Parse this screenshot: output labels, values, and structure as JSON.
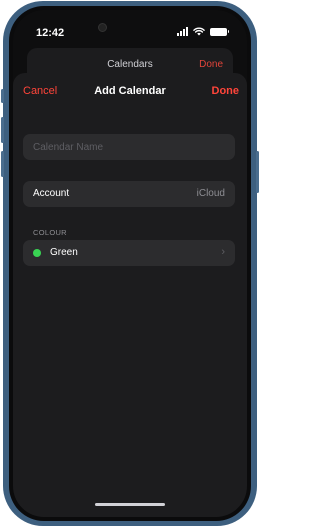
{
  "status_bar": {
    "time": "12:42"
  },
  "background_sheet": {
    "title": "Calendars",
    "done_label": "Done"
  },
  "nav": {
    "cancel_label": "Cancel",
    "title": "Add Calendar",
    "done_label": "Done"
  },
  "form": {
    "name_placeholder": "Calendar Name",
    "name_value": "",
    "account_label": "Account",
    "account_value": "iCloud",
    "colour_section_header": "COLOUR",
    "colour_label": "Green",
    "colour_hex": "#39d353"
  },
  "colors": {
    "accent": "#ff453a",
    "sheet_bg": "#1c1c1e",
    "row_bg": "#2c2c2e",
    "frame": "#3d5f7f"
  }
}
